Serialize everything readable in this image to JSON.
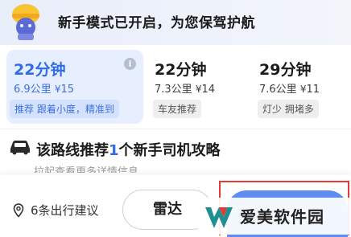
{
  "banner": {
    "text": "新手模式已开启，为您保驾护航",
    "mascot_icon": "helmet-mascot-icon"
  },
  "routes": [
    {
      "time": "22分钟",
      "distance": "6.9公里",
      "coin_icon": "¥",
      "fee": "15",
      "tag": "推荐 跟着小度，精准到",
      "selected": true
    },
    {
      "time": "22分钟",
      "distance": "7.3公里",
      "coin_icon": "¥",
      "fee": "14",
      "tag": "车友推荐",
      "selected": false
    },
    {
      "time": "29分钟",
      "distance": "7.6公里",
      "coin_icon": "¥",
      "fee": "11",
      "tag": "灯少 拥堵多",
      "selected": false
    }
  ],
  "info_symbol": "i",
  "guide": {
    "title_prefix": "该路线推荐",
    "count": "1",
    "title_suffix": "个新手司机攻略",
    "subtitle": "拉起查看更多详情信息"
  },
  "bottom": {
    "suggestions_label": "6条出行建议",
    "radar_button": "雷达"
  },
  "watermark": {
    "text": "爱美软件园"
  },
  "colors": {
    "accent": "#2f6de8",
    "selected_bg": "#e7effe",
    "highlight_border": "#e53935"
  }
}
